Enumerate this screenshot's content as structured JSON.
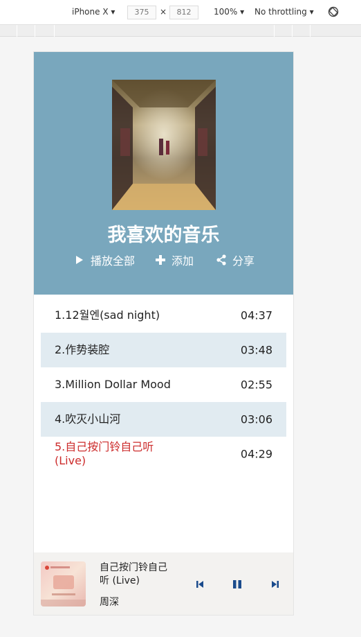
{
  "devtools": {
    "device": "iPhone X",
    "width": "375",
    "times": "×",
    "height": "812",
    "zoom": "100%",
    "throttling": "No throttling",
    "rotate_icon": "rotate-icon"
  },
  "playlist": {
    "title": "我喜欢的音乐",
    "actions": [
      {
        "label": "播放全部",
        "icon": "play-icon"
      },
      {
        "label": "添加",
        "icon": "plus-icon"
      },
      {
        "label": "分享",
        "icon": "share-icon"
      }
    ],
    "accent_color": "#79a7bd"
  },
  "songs": [
    {
      "name": "1.12월엔(sad night)",
      "duration": "04:37"
    },
    {
      "name": "2.作势装腔",
      "duration": "03:48"
    },
    {
      "name": "3.Million Dollar Mood",
      "duration": "02:55"
    },
    {
      "name": "4.吹灭小山河",
      "duration": "03:06"
    },
    {
      "name": "5.自己按门铃自己听 (Live)",
      "duration": "04:29"
    }
  ],
  "active_color": "#cc2b2b",
  "player": {
    "title": "自己按门铃自己听 (Live)",
    "artist": "周深",
    "controls": [
      "skip-previous-icon",
      "pause-icon",
      "skip-next-icon"
    ],
    "control_color": "#1a4b8c"
  }
}
